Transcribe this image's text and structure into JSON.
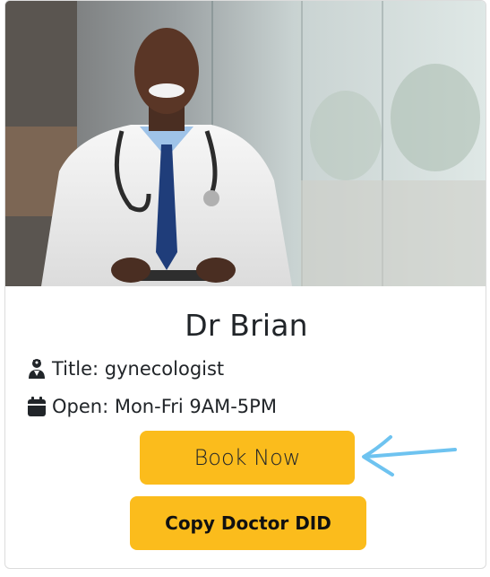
{
  "doctor": {
    "name": "Dr Brian",
    "title_text": "Title: gynecologist",
    "open_text": "Open: Mon-Fri 9AM-5PM"
  },
  "buttons": {
    "book_label": "Book Now",
    "copy_label": "Copy Doctor DID"
  },
  "icons": {
    "title_icon": "user-doctor-icon",
    "open_icon": "calendar-icon",
    "annotation": "arrow-left-annotation"
  },
  "colors": {
    "button": "#fbbc1c",
    "arrow": "#6ec3f0",
    "text": "#212529"
  }
}
